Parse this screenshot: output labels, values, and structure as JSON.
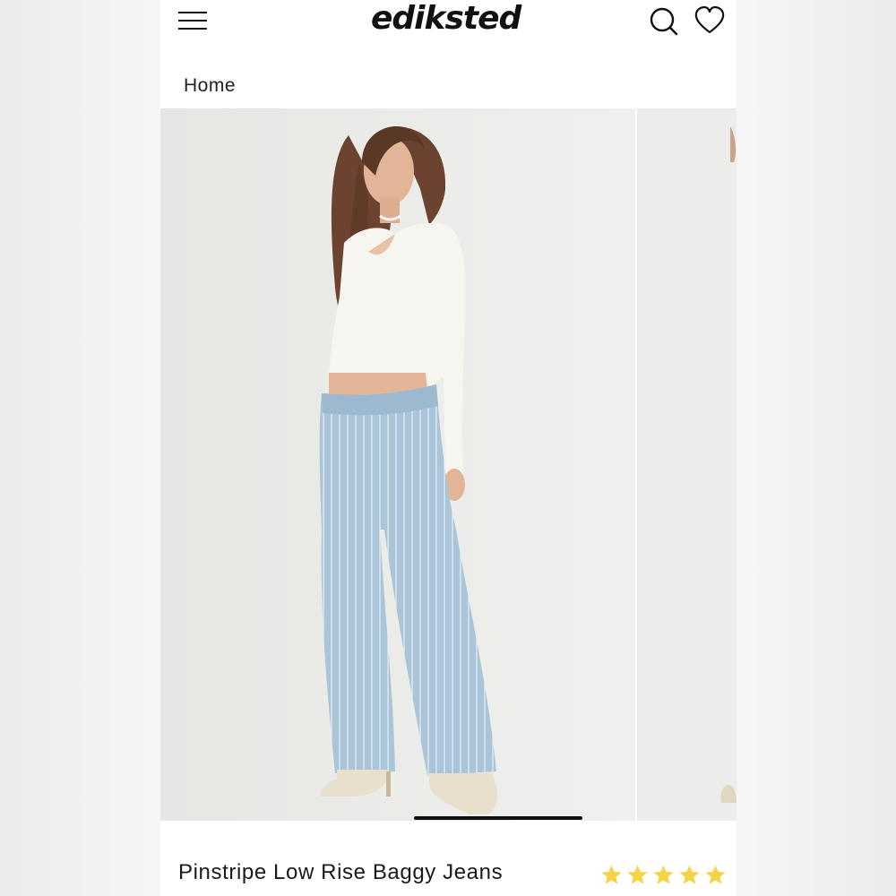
{
  "header": {
    "brand": "ediksted",
    "icons": [
      "hamburger-menu-icon",
      "search-icon",
      "heart-icon"
    ]
  },
  "breadcrumb": {
    "label": "Home"
  },
  "gallery": {
    "images": [
      "model-wearing-pinstripe-jeans",
      "next-product-image"
    ]
  },
  "product": {
    "title": "Pinstripe Low Rise Baggy Jeans",
    "rating": 5,
    "rating_max": 5
  },
  "colors": {
    "star": "#f5d547",
    "denim": "#a9c4d8",
    "sweater": "#f7f5ef",
    "background": "#ececea"
  }
}
